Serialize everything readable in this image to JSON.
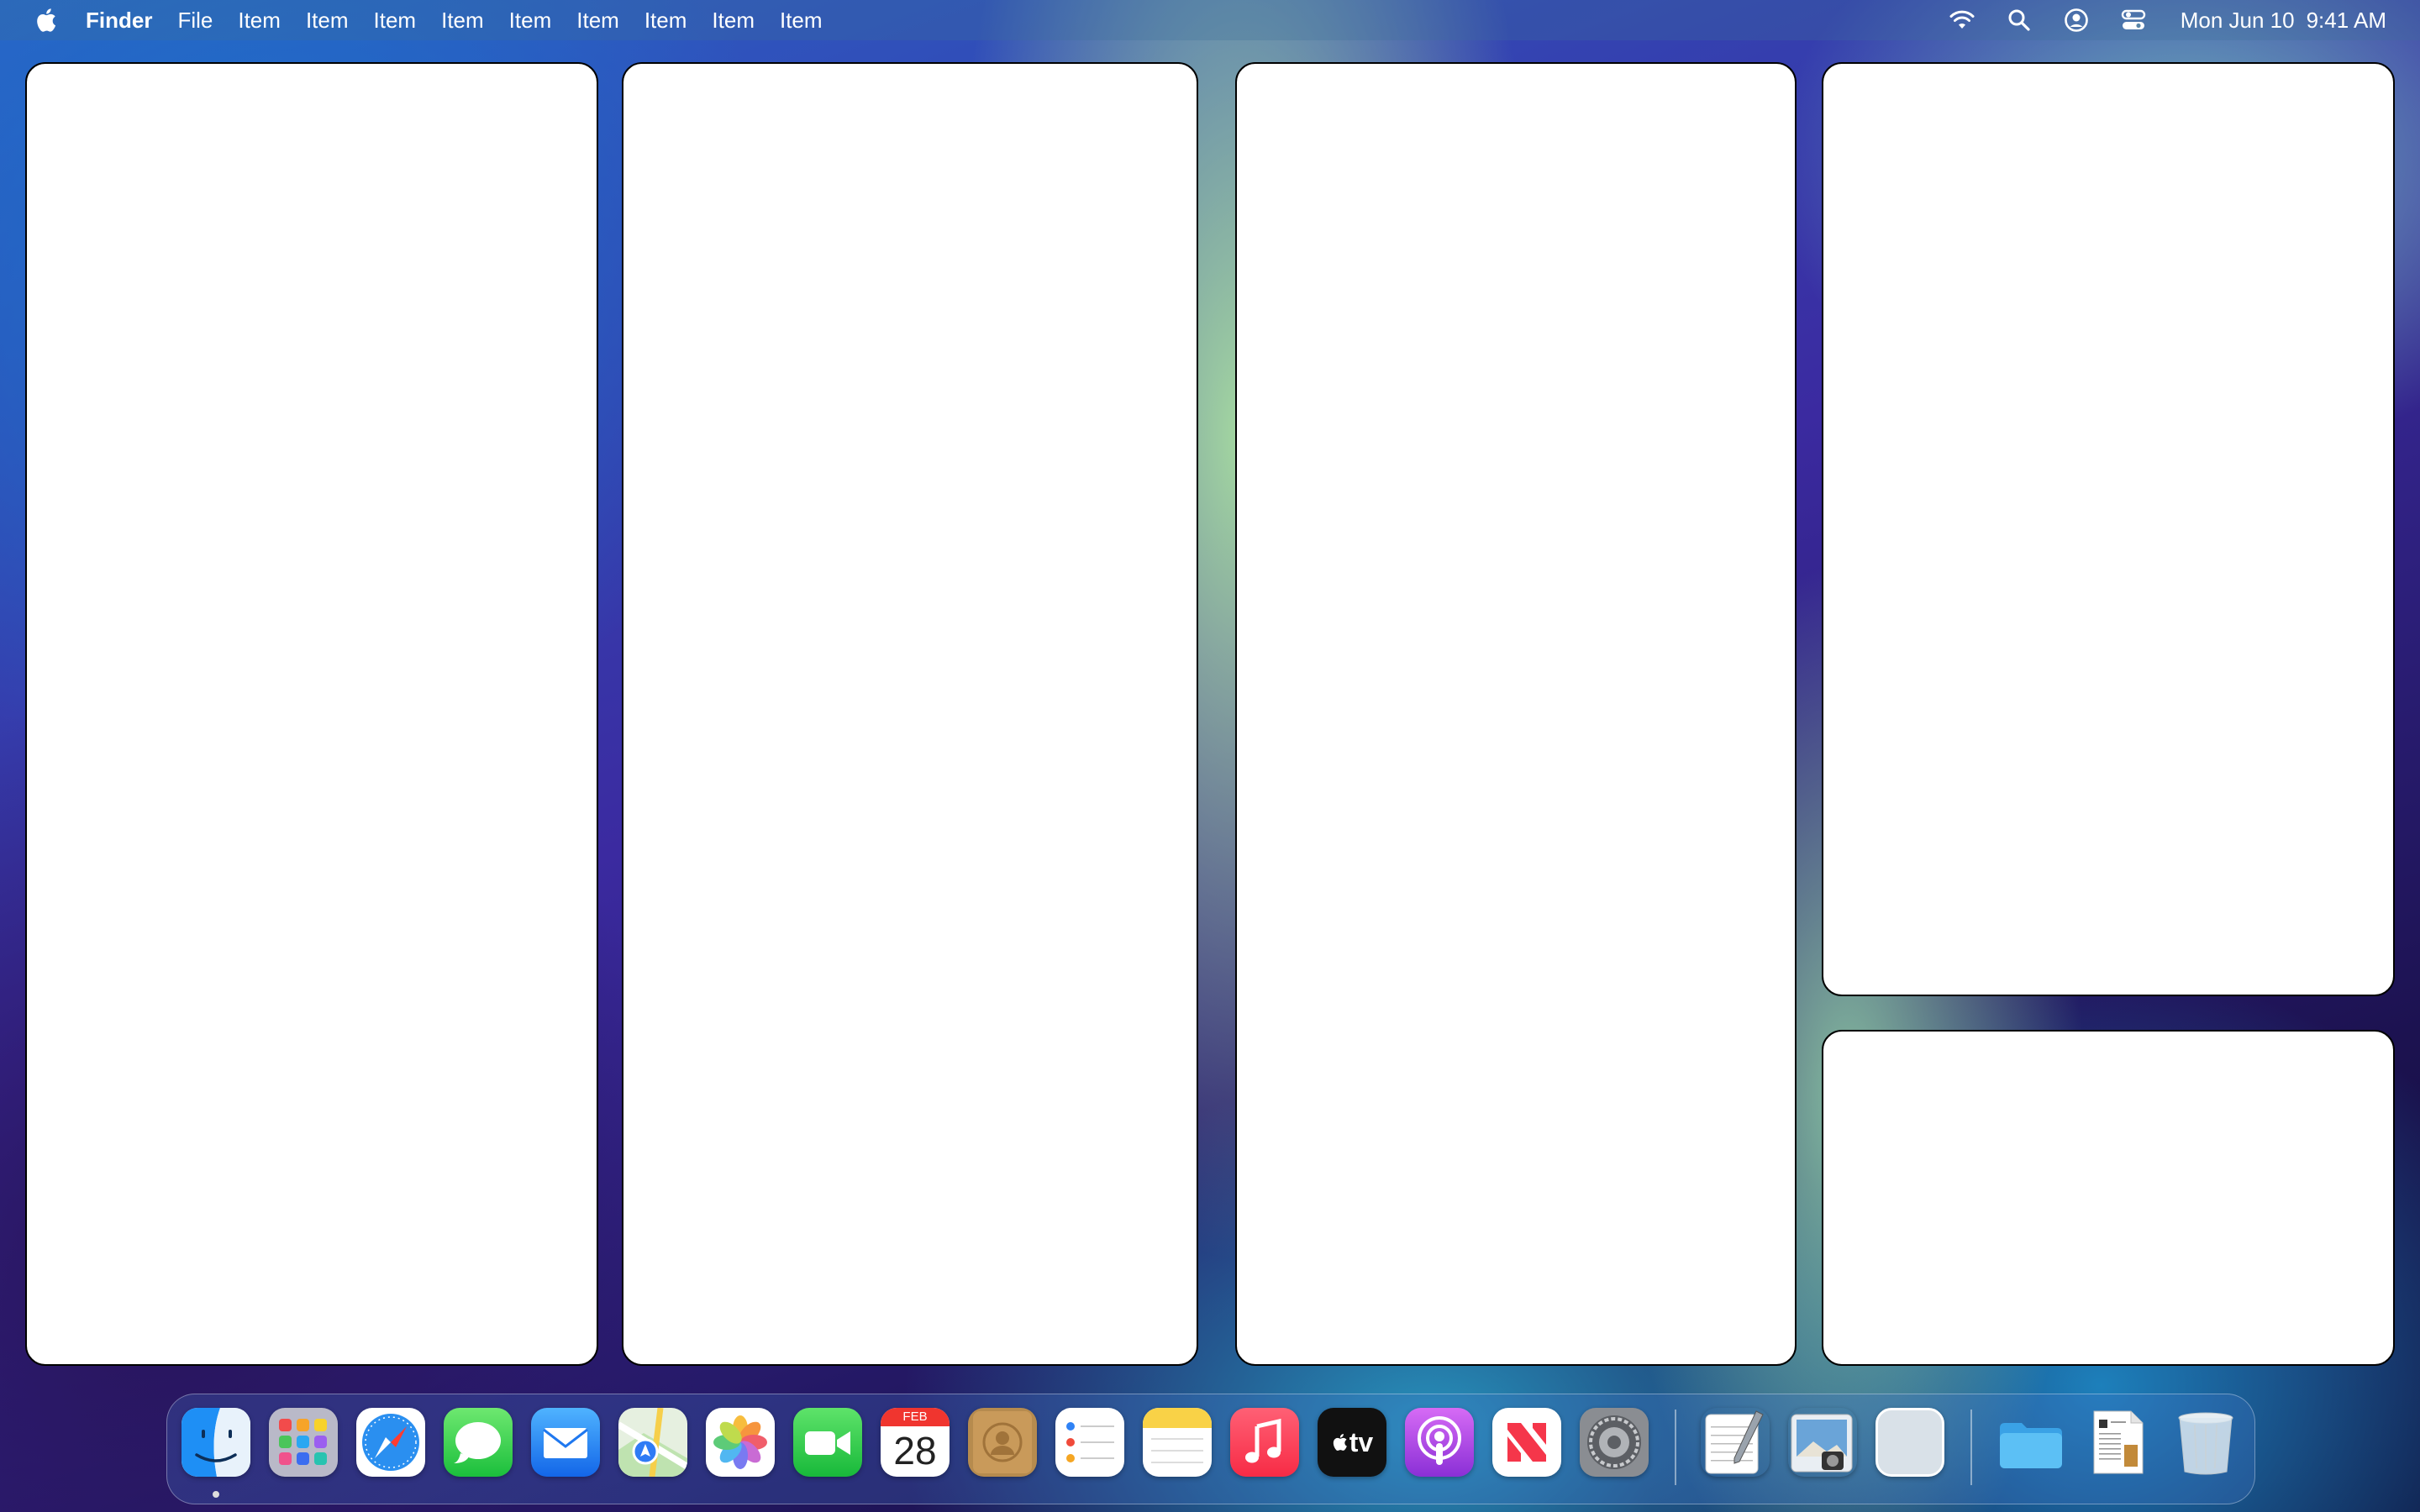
{
  "menubar": {
    "app_name": "Finder",
    "items": [
      "File",
      "Item",
      "Item",
      "Item",
      "Item",
      "Item",
      "Item",
      "Item",
      "Item",
      "Item"
    ],
    "status_icons": [
      "wifi-icon",
      "search-icon",
      "user-icon",
      "control-center-icon"
    ],
    "clock": {
      "date": "Mon Jun 10",
      "time": "9:41 AM"
    }
  },
  "windows": [
    "blank-window",
    "blank-window",
    "blank-window",
    "blank-window",
    "blank-window"
  ],
  "dock": {
    "apps": [
      "Finder",
      "Launchpad",
      "Safari",
      "Messages",
      "Mail",
      "Maps",
      "Photos",
      "FaceTime",
      "Calendar",
      "Contacts",
      "Reminders",
      "Notes",
      "Music",
      "TV",
      "Podcasts",
      "News",
      "System Settings",
      "TextEdit",
      "Preview",
      "Blank App"
    ],
    "calendar": {
      "month": "FEB",
      "day": "28"
    },
    "tv_label": "tv",
    "stacks": [
      "Folder",
      "Document"
    ],
    "trash": "Trash"
  }
}
